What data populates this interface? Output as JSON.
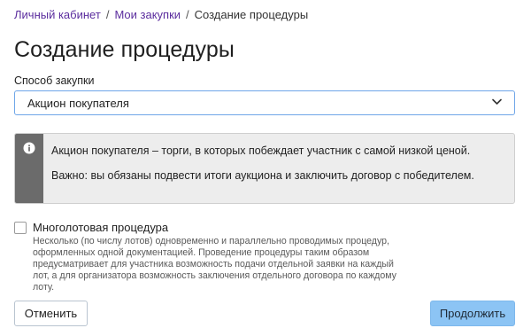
{
  "breadcrumb": {
    "items": [
      "Личный кабинет",
      "Мои закупки"
    ],
    "current": "Создание процедуры",
    "separator": "/"
  },
  "page": {
    "title": "Создание процедуры"
  },
  "purchase_method": {
    "label": "Способ закупки",
    "value": "Акцион покупателя"
  },
  "info": {
    "line1": "Акцион покупателя – торги, в которых побеждает участник с самой низкой ценой.",
    "line2": "Важно: вы обязаны подвести итоги аукциона и заключить договор с победителем.",
    "icon": "info-icon"
  },
  "multilot": {
    "label": "Многолотовая процедура",
    "checked": false,
    "description": "Несколько (по числу лотов) одновременно и параллельно проводимых процедур, оформленных одной документацией. Проведение процедуры таким образом предусматривает для участника возможность подачи отдельной заявки на каждый лот, а для организатора возможность заключения отдельного договора по каждому лоту."
  },
  "actions": {
    "cancel": "Отменить",
    "continue": "Продолжить"
  },
  "colors": {
    "link": "#5b2d9e",
    "select_border": "#6fa6e8",
    "info_stripe": "#6b6b6b",
    "primary_button": "#8cc4f4"
  }
}
